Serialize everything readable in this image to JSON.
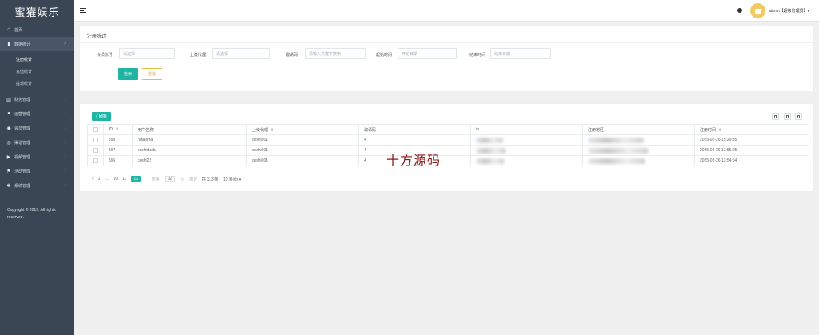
{
  "sidebar": {
    "logo": "蜜獾娱乐",
    "items": [
      {
        "label": "首页",
        "icon": "home-icon"
      },
      {
        "label": "数据统计",
        "icon": "bar-chart-icon",
        "expanded": true,
        "children": [
          {
            "label": "注册统计",
            "current": true
          },
          {
            "label": "充值统计"
          },
          {
            "label": "提现统计"
          }
        ]
      },
      {
        "label": "财务管理",
        "icon": "bank-icon"
      },
      {
        "label": "运营管理",
        "icon": "person-icon"
      },
      {
        "label": "会员管理",
        "icon": "users-icon"
      },
      {
        "label": "渠道管理",
        "icon": "channel-icon"
      },
      {
        "label": "视频管理",
        "icon": "video-icon"
      },
      {
        "label": "活动管理",
        "icon": "flag-icon"
      },
      {
        "label": "系统管理",
        "icon": "gear-icon"
      }
    ],
    "copyright_line1": "Copyright © 2019. All rights",
    "copyright_line2": "reserved."
  },
  "header": {
    "user": "admin【超级管理员】▾"
  },
  "filter": {
    "title": "注册统计",
    "member_label": "会员账号",
    "member_placeholder": "请选择",
    "agent_label": "上级代理",
    "agent_placeholder": "请选择",
    "invite_label": "邀请码",
    "invite_placeholder": "请输入关键字搜索",
    "start_label": "起始时间",
    "start_placeholder": "开始日期",
    "end_label": "结束时间",
    "end_placeholder": "结束日期",
    "search_label": "检索",
    "reset_label": "重置"
  },
  "table": {
    "refresh_label": "刷新",
    "columns": [
      "ID",
      "用户名称",
      "上级代理",
      "邀请码",
      "ip",
      "注册地区",
      "注册时间"
    ],
    "rows": [
      {
        "id": "598",
        "name": "nihaoma",
        "agent": "ceshi001",
        "code": "4",
        "time": "2025-02-26 15:29:35"
      },
      {
        "id": "597",
        "name": "ceshidada",
        "agent": "ceshi001",
        "code": "4",
        "time": "2025-02-26 13:55:25"
      },
      {
        "id": "596",
        "name": "ceshi22",
        "agent": "ceshi001",
        "code": "4",
        "time": "2025-02-26 13:54:54"
      }
    ],
    "pager": {
      "prev": "‹",
      "p1": "1",
      "ellipsis": "...",
      "p10": "10",
      "p11": "11",
      "p12": "12",
      "next": "›",
      "goto": "到第",
      "goto_value": "12",
      "page_unit": "页",
      "confirm": "确定",
      "total": "共 113 条",
      "per_page": "10 条/页 ▾"
    }
  },
  "watermark": "十方源码"
}
